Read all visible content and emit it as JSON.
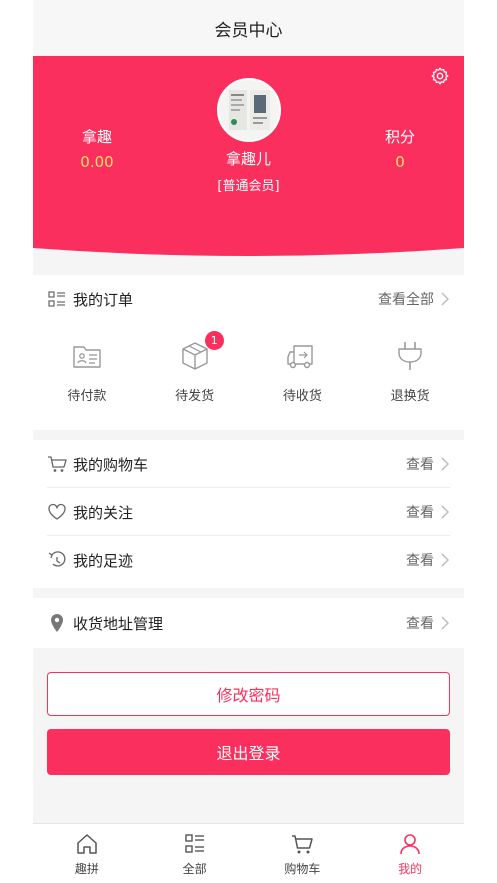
{
  "header": {
    "title": "会员中心"
  },
  "colors": {
    "accent": "#fb2f5e",
    "value_yellow": "#ffe066"
  },
  "profile": {
    "left_label": "拿趣",
    "left_value": "0.00",
    "username": "拿趣儿",
    "level": "[普通会员]",
    "right_label": "积分",
    "right_value": "0",
    "settings_icon": "gear-icon"
  },
  "orders": {
    "title": "我的订单",
    "view_all": "查看全部",
    "items": [
      {
        "label": "待付款",
        "icon": "pending-payment-icon",
        "badge": ""
      },
      {
        "label": "待发货",
        "icon": "box-icon",
        "badge": "1"
      },
      {
        "label": "待收货",
        "icon": "truck-icon",
        "badge": ""
      },
      {
        "label": "退换货",
        "icon": "return-plug-icon",
        "badge": ""
      }
    ]
  },
  "links": [
    {
      "label": "我的购物车",
      "more": "查看",
      "icon": "cart-icon"
    },
    {
      "label": "我的关注",
      "more": "查看",
      "icon": "heart-icon"
    },
    {
      "label": "我的足迹",
      "more": "查看",
      "icon": "footprint-icon"
    }
  ],
  "address": {
    "label": "收货地址管理",
    "more": "查看",
    "icon": "location-pin-icon"
  },
  "buttons": {
    "change_password": "修改密码",
    "logout": "退出登录"
  },
  "tabbar": [
    {
      "label": "趣拼",
      "icon": "home-icon",
      "active": false
    },
    {
      "label": "全部",
      "icon": "list-icon",
      "active": false
    },
    {
      "label": "购物车",
      "icon": "cart-icon",
      "active": false
    },
    {
      "label": "我的",
      "icon": "user-icon",
      "active": true
    }
  ]
}
